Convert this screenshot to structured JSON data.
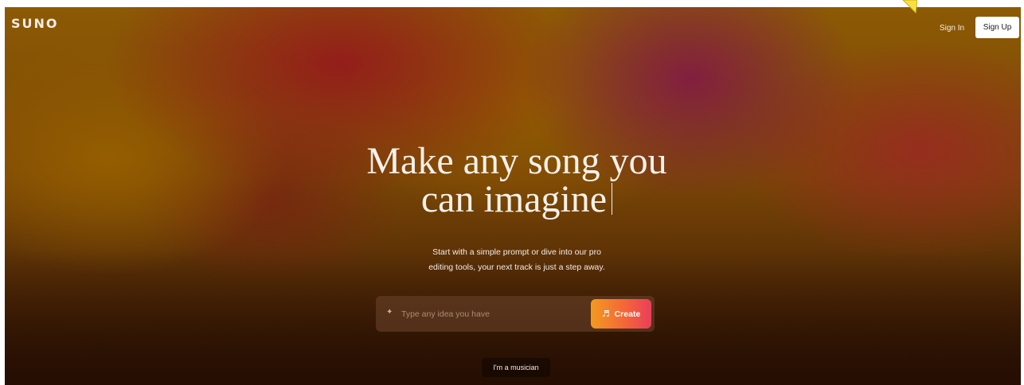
{
  "header": {
    "logo": "SUNO",
    "sign_in_label": "Sign In",
    "sign_up_label": "Sign Up"
  },
  "hero": {
    "title_line1": "Make any song you",
    "title_line2": "can imagine",
    "subtitle_line1": "Start with a simple prompt or dive into our pro",
    "subtitle_line2": "editing tools, your next track is just a step away."
  },
  "prompt": {
    "placeholder": "Type any idea you have",
    "value": "",
    "sparkle_icon": "sparkle-icon",
    "create_label": "Create",
    "create_icon": "music-note-icon"
  },
  "secondary": {
    "musician_label": "I'm a musician"
  },
  "colors": {
    "create_gradient_start": "#f39a1f",
    "create_gradient_end": "#ea3e5c",
    "cursor_highlight": "#f7e040"
  }
}
